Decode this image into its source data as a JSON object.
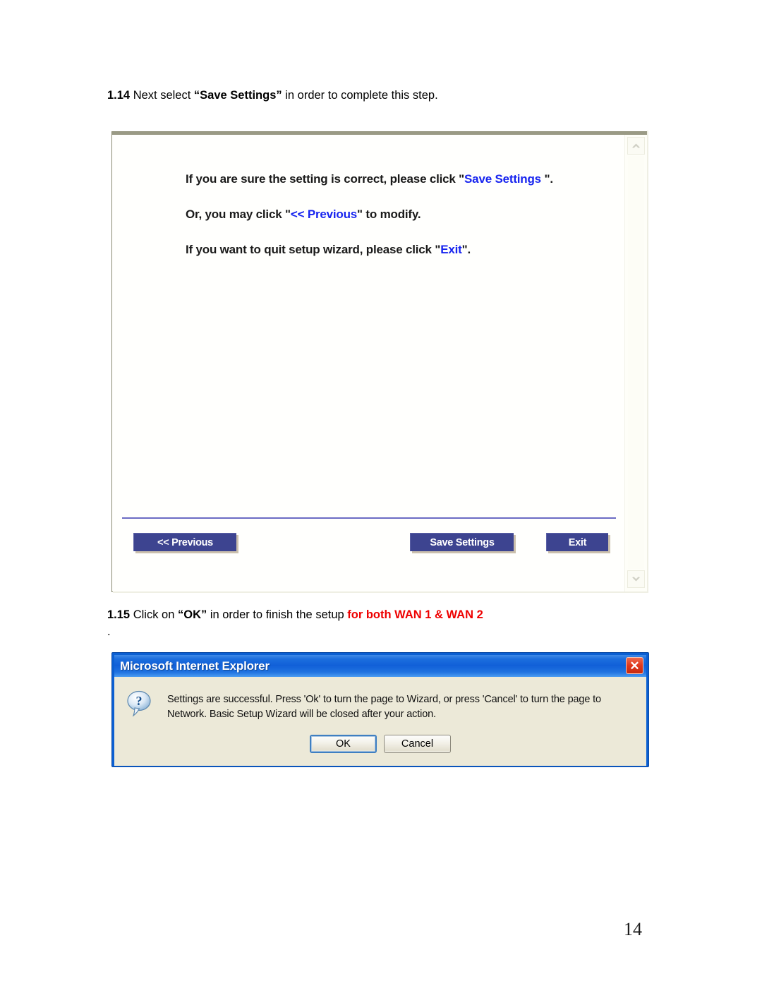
{
  "document": {
    "page_number": "14",
    "steps": [
      {
        "number": "1.14",
        "text_before": " Next select ",
        "quoted": "“Save Settings”",
        "text_after": " in order to complete this step."
      },
      {
        "number": "1.15",
        "text_before": " Click on ",
        "quoted": "“OK”",
        "text_after": " in order to finish the setup ",
        "highlight": "for both WAN 1 & WAN 2",
        "trailing": "."
      }
    ]
  },
  "router_wizard": {
    "lines": [
      {
        "pre": "If you are sure the setting is correct, please click \"",
        "link": "Save Settings",
        "post": " \"."
      },
      {
        "pre": "Or, you may click \"",
        "link": "<< Previous",
        "post": "\" to modify."
      },
      {
        "pre": "If you want to quit setup wizard, please click \"",
        "link": "Exit",
        "post": "\"."
      }
    ],
    "buttons": {
      "previous": "<< Previous",
      "save_settings": "Save Settings",
      "exit": "Exit"
    },
    "scrollbar": {
      "up_icon": "chevron-up-icon",
      "down_icon": "chevron-down-icon"
    },
    "colors": {
      "button_bg": "#3d4490",
      "button_shadow": "#cbc0ad",
      "link": "#1724ef",
      "divider": "#6b6bc4"
    }
  },
  "ie_dialog": {
    "title": "Microsoft Internet Explorer",
    "close_glyph": "✕",
    "icon": "question-bubble-icon",
    "message": "Settings are successful. Press 'Ok' to turn the page to Wizard, or press 'Cancel' to turn the page to Network. Basic Setup Wizard will be closed after your action.",
    "buttons": {
      "ok": "OK",
      "cancel": "Cancel"
    },
    "colors": {
      "titlebar": "#1160d8",
      "body": "#ece9d8",
      "close_button": "#e0381c"
    }
  }
}
